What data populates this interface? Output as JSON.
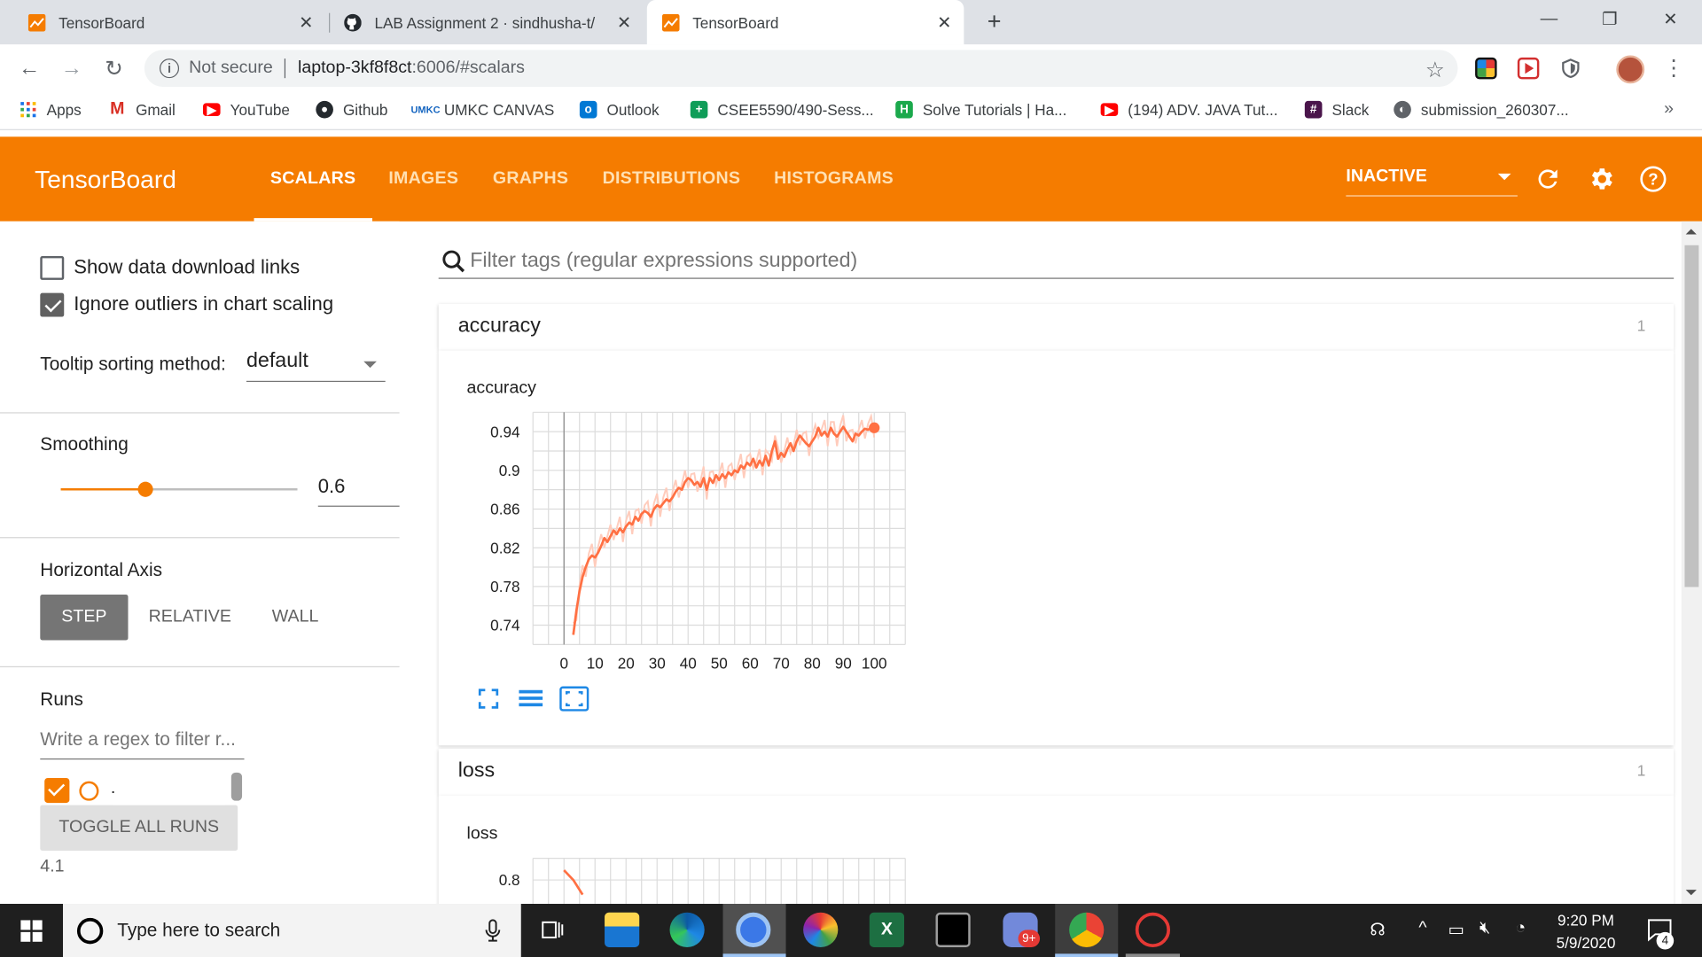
{
  "browser": {
    "tabs": [
      {
        "title": "TensorBoard",
        "active": false
      },
      {
        "title": "LAB Assignment 2 · sindhusha-t/",
        "active": false
      },
      {
        "title": "TensorBoard",
        "active": true
      }
    ],
    "omnibox": {
      "security": "Not secure",
      "host": "laptop-3kf8f8ct",
      "path": ":6006/#scalars"
    },
    "bookmarks": [
      {
        "label": "Apps",
        "icon": "apps-grid-icon"
      },
      {
        "label": "Gmail",
        "icon": "gmail-icon"
      },
      {
        "label": "YouTube",
        "icon": "youtube-icon"
      },
      {
        "label": "Github",
        "icon": "github-icon"
      },
      {
        "label": "UMKC CANVAS",
        "icon": "umkc-icon"
      },
      {
        "label": "Outlook",
        "icon": "outlook-icon"
      },
      {
        "label": "CSEE5590/490-Sess...",
        "icon": "plus-icon"
      },
      {
        "label": "Solve Tutorials | Ha...",
        "icon": "hackerrank-icon"
      },
      {
        "label": "(194) ADV. JAVA Tut...",
        "icon": "youtube-icon"
      },
      {
        "label": "Slack",
        "icon": "slack-icon"
      },
      {
        "label": "submission_260307...",
        "icon": "globe-icon"
      }
    ]
  },
  "tensorboard": {
    "logo": "TensorBoard",
    "nav": [
      "SCALARS",
      "IMAGES",
      "GRAPHS",
      "DISTRIBUTIONS",
      "HISTOGRAMS"
    ],
    "active_nav": "SCALARS",
    "run_state": "INACTIVE",
    "accent": "#f57c00"
  },
  "sidebar": {
    "show_download_links": {
      "label": "Show data download links",
      "checked": false
    },
    "ignore_outliers": {
      "label": "Ignore outliers in chart scaling",
      "checked": true
    },
    "tooltip_sorting": {
      "label": "Tooltip sorting method:",
      "value": "default"
    },
    "smoothing": {
      "label": "Smoothing",
      "value": "0.6",
      "fraction": 0.6
    },
    "horizontal_axis": {
      "label": "Horizontal Axis",
      "options": [
        "STEP",
        "RELATIVE",
        "WALL"
      ],
      "selected": "STEP"
    },
    "runs": {
      "label": "Runs",
      "filter_placeholder": "Write a regex to filter r...",
      "items": [
        {
          "name": ".",
          "checked": true
        }
      ],
      "toggle_label": "TOGGLE ALL RUNS",
      "footer": "4.1"
    }
  },
  "main": {
    "filter_placeholder": "Filter tags (regular expressions supported)",
    "cards": [
      {
        "name": "accuracy",
        "count": "1",
        "chart_title": "accuracy"
      },
      {
        "name": "loss",
        "count": "1",
        "chart_title": "loss"
      }
    ]
  },
  "chart_data": [
    {
      "type": "line",
      "title": "accuracy",
      "xlabel": "",
      "ylabel": "",
      "xlim": [
        -10,
        110
      ],
      "ylim": [
        0.72,
        0.96
      ],
      "x_ticks": [
        "0",
        "10",
        "20",
        "30",
        "40",
        "50",
        "60",
        "70",
        "80",
        "90",
        "100"
      ],
      "y_ticks": [
        "0.74",
        "0.78",
        "0.82",
        "0.86",
        "0.9",
        "0.94"
      ],
      "grid": true,
      "series": [
        {
          "color": "#ff7043",
          "x": [
            3,
            4,
            5,
            6,
            7,
            8,
            9,
            10,
            11,
            12,
            13,
            14,
            15,
            16,
            17,
            18,
            19,
            20,
            21,
            22,
            23,
            24,
            25,
            26,
            27,
            28,
            29,
            30,
            31,
            32,
            33,
            34,
            35,
            36,
            37,
            38,
            39,
            40,
            41,
            42,
            43,
            44,
            45,
            46,
            47,
            48,
            49,
            50,
            51,
            52,
            53,
            54,
            55,
            56,
            57,
            58,
            59,
            60,
            61,
            62,
            63,
            64,
            65,
            66,
            67,
            68,
            69,
            70,
            71,
            72,
            73,
            74,
            75,
            76,
            77,
            78,
            79,
            80,
            81,
            82,
            83,
            84,
            85,
            86,
            87,
            88,
            89,
            90,
            91,
            92,
            93,
            94,
            95,
            96,
            97,
            98,
            99,
            100
          ],
          "values": [
            0.73,
            0.755,
            0.775,
            0.79,
            0.8,
            0.808,
            0.812,
            0.81,
            0.815,
            0.822,
            0.83,
            0.826,
            0.832,
            0.838,
            0.834,
            0.84,
            0.836,
            0.842,
            0.846,
            0.844,
            0.852,
            0.848,
            0.855,
            0.858,
            0.856,
            0.852,
            0.86,
            0.864,
            0.862,
            0.866,
            0.87,
            0.868,
            0.872,
            0.878,
            0.882,
            0.88,
            0.888,
            0.892,
            0.89,
            0.885,
            0.888,
            0.883,
            0.892,
            0.88,
            0.892,
            0.887,
            0.895,
            0.89,
            0.896,
            0.892,
            0.898,
            0.895,
            0.9,
            0.898,
            0.905,
            0.902,
            0.908,
            0.905,
            0.912,
            0.903,
            0.91,
            0.905,
            0.915,
            0.905,
            0.92,
            0.93,
            0.912,
            0.918,
            0.914,
            0.922,
            0.928,
            0.92,
            0.93,
            0.936,
            0.932,
            0.928,
            0.925,
            0.93,
            0.935,
            0.944,
            0.936,
            0.94,
            0.935,
            0.944,
            0.938,
            0.935,
            0.94,
            0.945,
            0.94,
            0.935,
            0.93,
            0.938,
            0.936,
            0.94,
            0.943,
            0.942,
            0.944,
            0.944
          ]
        }
      ]
    },
    {
      "type": "line",
      "title": "loss",
      "xlabel": "",
      "ylabel": "",
      "y_ticks": [
        "0.8"
      ],
      "grid": true,
      "series": [
        {
          "color": "#ff7043",
          "x": [
            0,
            3,
            6
          ],
          "values": [
            0.82,
            0.8,
            0.77
          ]
        }
      ]
    }
  ],
  "taskbar": {
    "search_placeholder": "Type here to search",
    "time": "9:20 PM",
    "date": "5/9/2020",
    "notification_count": "4",
    "badge": "9+"
  }
}
